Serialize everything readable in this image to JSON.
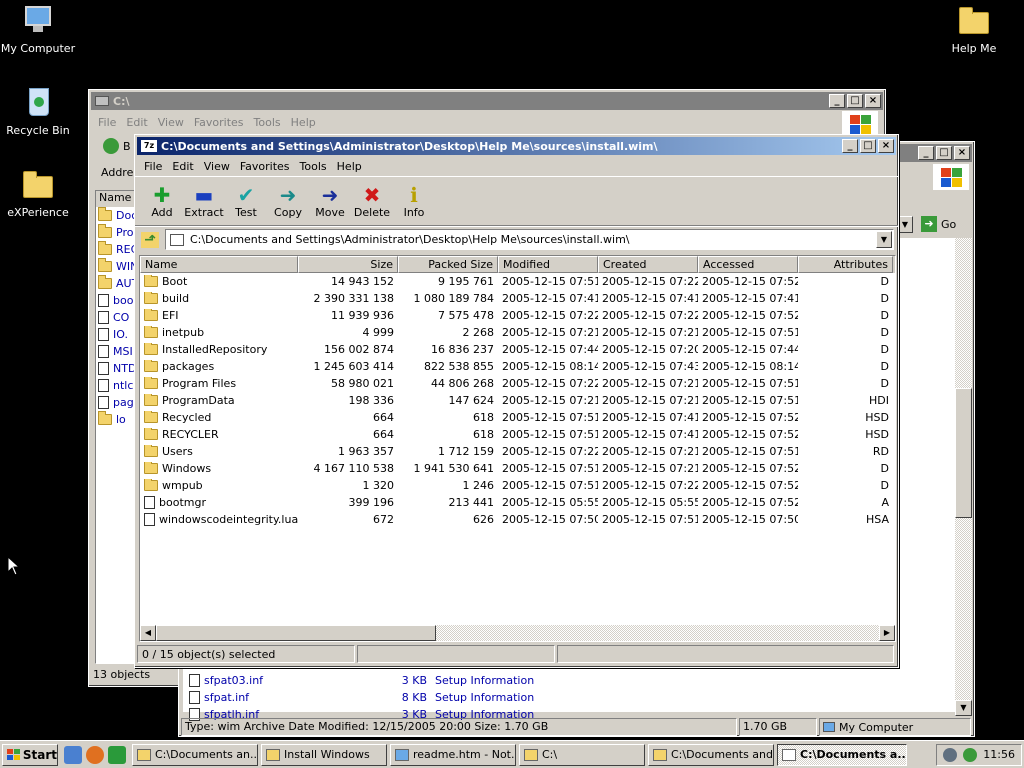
{
  "desktop": {
    "icons": [
      {
        "label": "My Computer",
        "icon": "my-computer-icon"
      },
      {
        "label": "Recycle Bin",
        "icon": "recycle-bin-icon"
      },
      {
        "label": "eXPerience",
        "icon": "folder-icon"
      },
      {
        "label": "Help Me",
        "icon": "folder-icon"
      }
    ]
  },
  "explorer_c": {
    "title": "C:\\",
    "menu": [
      "File",
      "Edit",
      "View",
      "Favorites",
      "Tools",
      "Help"
    ],
    "back_label": "B",
    "address_label": "Addre",
    "name_col": "Name",
    "tree": [
      "Doc",
      "Pro",
      "REC",
      "WIN",
      "AUT",
      "boo",
      "CO",
      "IO.",
      "MSI",
      "NTD",
      "ntlc",
      "pag",
      "lo"
    ],
    "status": "13 objects"
  },
  "explorer_sources": {
    "go_label": "Go",
    "files": [
      {
        "name": "sfpat03.inf",
        "size": "3 KB",
        "type": "Setup Information"
      },
      {
        "name": "sfpat.inf",
        "size": "8 KB",
        "type": "Setup Information"
      },
      {
        "name": "sfpatlh.inf",
        "size": "3 KB",
        "type": "Setup Information"
      }
    ],
    "status_left": "Type: wim Archive Date Modified: 12/15/2005 20:00 Size: 1.70 GB",
    "status_size": "1.70 GB",
    "status_zone": "My Computer"
  },
  "sevenzip": {
    "title": "C:\\Documents and Settings\\Administrator\\Desktop\\Help Me\\sources\\install.wim\\",
    "menu": [
      "File",
      "Edit",
      "View",
      "Favorites",
      "Tools",
      "Help"
    ],
    "tools": [
      {
        "label": "Add",
        "icon": "plus-icon",
        "color": "#1a9e2e",
        "glyph": "✚"
      },
      {
        "label": "Extract",
        "icon": "minus-icon",
        "color": "#1a3fbf",
        "glyph": "▬"
      },
      {
        "label": "Test",
        "icon": "test-check-icon",
        "color": "#1aa3a3",
        "glyph": "✔"
      },
      {
        "label": "Copy",
        "icon": "copy-arrow-icon",
        "color": "#1a8a8a",
        "glyph": "➜"
      },
      {
        "label": "Move",
        "icon": "move-arrow-icon",
        "color": "#1a2f9a",
        "glyph": "➜"
      },
      {
        "label": "Delete",
        "icon": "delete-x-icon",
        "color": "#d01818",
        "glyph": "✖"
      },
      {
        "label": "Info",
        "icon": "info-icon",
        "color": "#b8a000",
        "glyph": "ℹ"
      }
    ],
    "address": "C:\\Documents and Settings\\Administrator\\Desktop\\Help Me\\sources\\install.wim\\",
    "columns": [
      "Name",
      "Size",
      "Packed Size",
      "Modified",
      "Created",
      "Accessed",
      "Attributes"
    ],
    "rows": [
      {
        "name": "Boot",
        "kind": "folder",
        "size": "14 943 152",
        "packed": "9 195 761",
        "modified": "2005-12-15 07:51",
        "created": "2005-12-15 07:22",
        "accessed": "2005-12-15 07:52",
        "attr": "D"
      },
      {
        "name": "build",
        "kind": "folder",
        "size": "2 390 331 138",
        "packed": "1 080 189 784",
        "modified": "2005-12-15 07:41",
        "created": "2005-12-15 07:41",
        "accessed": "2005-12-15 07:41",
        "attr": "D"
      },
      {
        "name": "EFI",
        "kind": "folder",
        "size": "11 939 936",
        "packed": "7 575 478",
        "modified": "2005-12-15 07:22",
        "created": "2005-12-15 07:22",
        "accessed": "2005-12-15 07:52",
        "attr": "D"
      },
      {
        "name": "inetpub",
        "kind": "folder",
        "size": "4 999",
        "packed": "2 268",
        "modified": "2005-12-15 07:21",
        "created": "2005-12-15 07:21",
        "accessed": "2005-12-15 07:51",
        "attr": "D"
      },
      {
        "name": "InstalledRepository",
        "kind": "folder",
        "size": "156 002 874",
        "packed": "16 836 237",
        "modified": "2005-12-15 07:44",
        "created": "2005-12-15 07:20",
        "accessed": "2005-12-15 07:44",
        "attr": "D"
      },
      {
        "name": "packages",
        "kind": "folder",
        "size": "1 245 603 414",
        "packed": "822 538 855",
        "modified": "2005-12-15 08:14",
        "created": "2005-12-15 07:43",
        "accessed": "2005-12-15 08:14",
        "attr": "D"
      },
      {
        "name": "Program Files",
        "kind": "folder",
        "size": "58 980 021",
        "packed": "44 806 268",
        "modified": "2005-12-15 07:22",
        "created": "2005-12-15 07:21",
        "accessed": "2005-12-15 07:51",
        "attr": "D"
      },
      {
        "name": "ProgramData",
        "kind": "folder",
        "size": "198 336",
        "packed": "147 624",
        "modified": "2005-12-15 07:21",
        "created": "2005-12-15 07:21",
        "accessed": "2005-12-15 07:51",
        "attr": "HDI"
      },
      {
        "name": "Recycled",
        "kind": "folder",
        "size": "664",
        "packed": "618",
        "modified": "2005-12-15 07:51",
        "created": "2005-12-15 07:41",
        "accessed": "2005-12-15 07:52",
        "attr": "HSD"
      },
      {
        "name": "RECYCLER",
        "kind": "folder",
        "size": "664",
        "packed": "618",
        "modified": "2005-12-15 07:51",
        "created": "2005-12-15 07:41",
        "accessed": "2005-12-15 07:52",
        "attr": "HSD"
      },
      {
        "name": "Users",
        "kind": "folder",
        "size": "1 963 357",
        "packed": "1 712 159",
        "modified": "2005-12-15 07:22",
        "created": "2005-12-15 07:21",
        "accessed": "2005-12-15 07:51",
        "attr": "RD"
      },
      {
        "name": "Windows",
        "kind": "folder",
        "size": "4 167 110 538",
        "packed": "1 941 530 641",
        "modified": "2005-12-15 07:51",
        "created": "2005-12-15 07:21",
        "accessed": "2005-12-15 07:52",
        "attr": "D"
      },
      {
        "name": "wmpub",
        "kind": "folder",
        "size": "1 320",
        "packed": "1 246",
        "modified": "2005-12-15 07:51",
        "created": "2005-12-15 07:22",
        "accessed": "2005-12-15 07:52",
        "attr": "D"
      },
      {
        "name": "bootmgr",
        "kind": "file",
        "size": "399 196",
        "packed": "213 441",
        "modified": "2005-12-15 05:55",
        "created": "2005-12-15 05:55",
        "accessed": "2005-12-15 07:52",
        "attr": "A"
      },
      {
        "name": "windowscodeintegrity.lua...",
        "kind": "file",
        "size": "672",
        "packed": "626",
        "modified": "2005-12-15 07:50",
        "created": "2005-12-15 07:51",
        "accessed": "2005-12-15 07:50",
        "attr": "HSA"
      }
    ],
    "status": "0 / 15 object(s) selected"
  },
  "taskbar": {
    "start": "Start",
    "tasks": [
      {
        "label": "C:\\Documents an...",
        "pressed": false
      },
      {
        "label": "Install Windows",
        "pressed": false
      },
      {
        "label": "readme.htm - Not...",
        "pressed": false
      },
      {
        "label": "C:\\",
        "pressed": false
      },
      {
        "label": "C:\\Documents and...",
        "pressed": false
      },
      {
        "label": "C:\\Documents a...",
        "pressed": true
      }
    ],
    "clock": "11:56"
  }
}
